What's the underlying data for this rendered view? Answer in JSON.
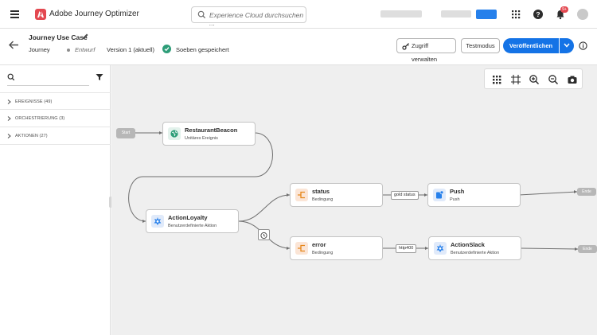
{
  "app": {
    "name": "Adobe Journey Optimizer",
    "search_placeholder": "Experience Cloud durchsuchen ...",
    "notification_count": "9+"
  },
  "header": {
    "title": "Journey Use Case",
    "type": "Journey",
    "status": "Entwurf",
    "version": "Version 1 (aktuell)",
    "saved": "Soeben gespeichert",
    "buttons": {
      "access": "Zugriff verwalten",
      "test": "Testmodus",
      "publish": "Veröffentlichen"
    }
  },
  "sidebar": {
    "categories": [
      {
        "label": "EREIGNISSE (49)"
      },
      {
        "label": "ORCHESTRIERUNG (3)"
      },
      {
        "label": "AKTIONEN (27)"
      }
    ]
  },
  "canvas": {
    "start": "Start",
    "nodes": [
      {
        "title": "RestaurantBeacon",
        "subtitle": "Unitäres Ereignis"
      },
      {
        "title": "ActionLoyalty",
        "subtitle": "Benutzerdefinierte Aktion"
      },
      {
        "title": "status",
        "subtitle": "Bedingung"
      },
      {
        "title": "Push",
        "subtitle": "Push"
      },
      {
        "title": "error",
        "subtitle": "Bedingung"
      },
      {
        "title": "ActionSlack",
        "subtitle": "Benutzerdefinierte Aktion"
      }
    ],
    "edge_labels": {
      "gold": "gold status",
      "http": "http400"
    },
    "end": "Ende"
  },
  "colors": {
    "accent": "#1473e6",
    "brand": "#e34850",
    "saved": "#2d9d78"
  }
}
